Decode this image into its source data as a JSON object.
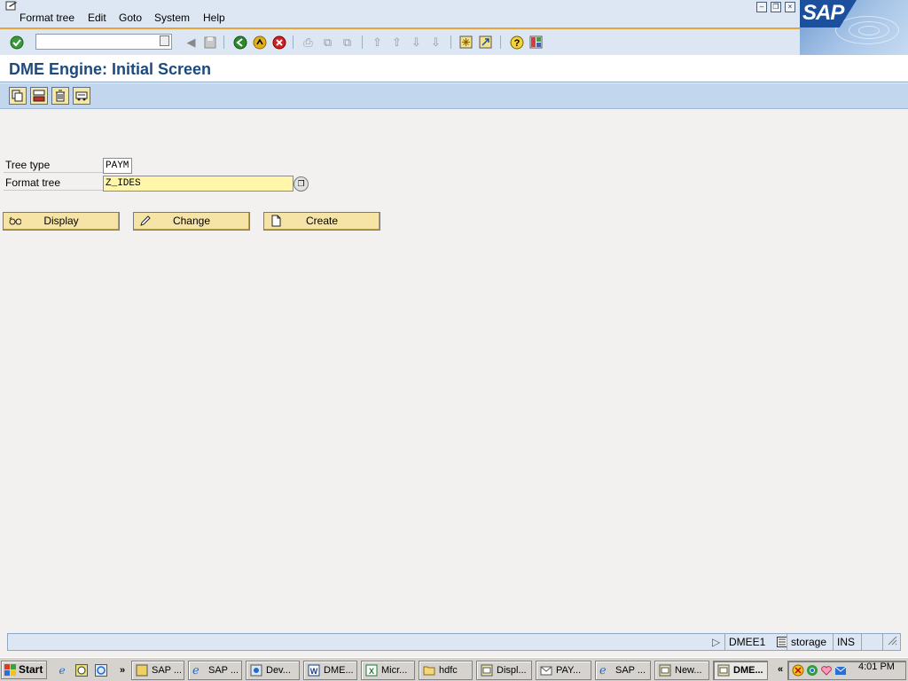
{
  "menubar": {
    "items": [
      {
        "label": "Format tree"
      },
      {
        "label": "Edit"
      },
      {
        "label": "Goto"
      },
      {
        "label": "System"
      },
      {
        "label": "Help"
      }
    ]
  },
  "logo": {
    "text": "SAP"
  },
  "title": "DME Engine: Initial Screen",
  "form": {
    "tree_type": {
      "label": "Tree type",
      "value": "PAYM"
    },
    "format_tree": {
      "label": "Format tree",
      "value": "Z_IDES"
    }
  },
  "actions": {
    "display": "Display",
    "change": "Change",
    "create": "Create"
  },
  "status": {
    "transaction": "DMEE1",
    "server": "storage",
    "mode": "INS"
  },
  "taskbar": {
    "start": "Start",
    "overflow": "»",
    "tasks": [
      {
        "label": "SAP ..."
      },
      {
        "label": "SAP ..."
      },
      {
        "label": "Dev..."
      },
      {
        "label": "DME..."
      },
      {
        "label": "Micr..."
      },
      {
        "label": "hdfc"
      },
      {
        "label": "Displ..."
      },
      {
        "label": "PAY..."
      },
      {
        "label": "SAP ..."
      },
      {
        "label": "New..."
      },
      {
        "label": "DME..."
      }
    ],
    "tray_chevron": "«",
    "clock": "4:01 PM"
  },
  "colors": {
    "accent": "#e6a33a",
    "title": "#1c4a7f",
    "required_field": "#fff6a9",
    "button": "#f5e4a6"
  }
}
